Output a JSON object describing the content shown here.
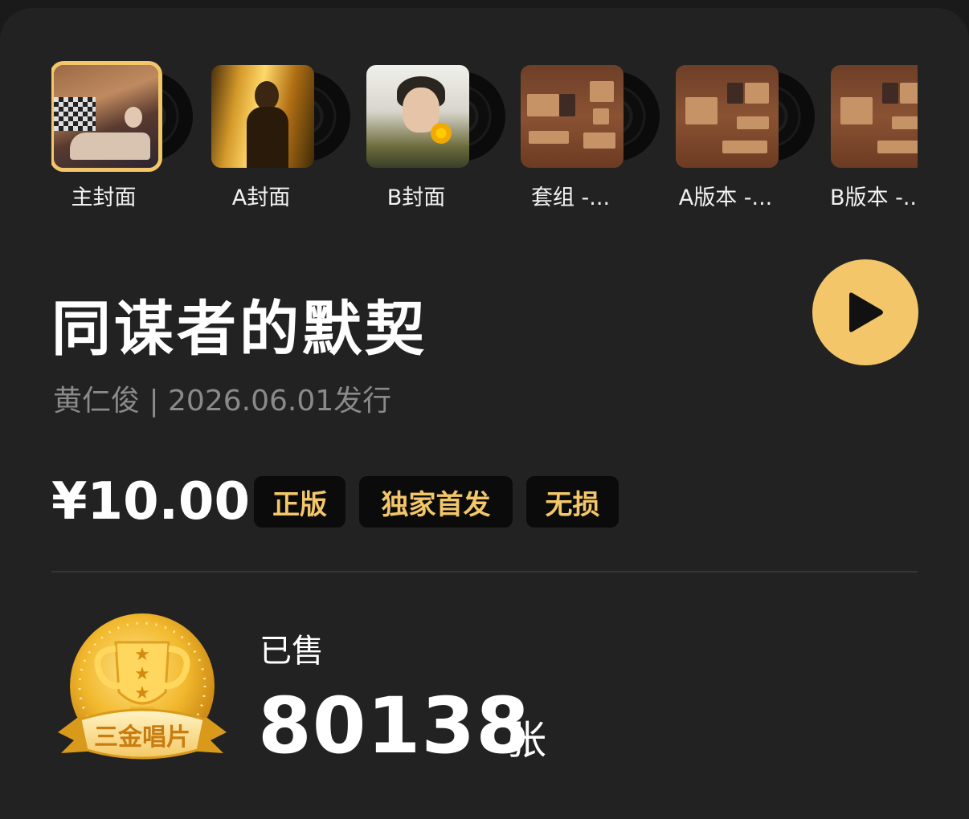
{
  "covers": [
    {
      "label": "主封面",
      "selected": true
    },
    {
      "label": "A封面",
      "selected": false
    },
    {
      "label": "B封面",
      "selected": false
    },
    {
      "label": "套组 -...",
      "selected": false
    },
    {
      "label": "A版本 -...",
      "selected": false
    },
    {
      "label": "B版本 -..",
      "selected": false
    }
  ],
  "album": {
    "title": "同谋者的默契",
    "meta": "黄仁俊 | 2026.06.01发行",
    "price": "¥10.00",
    "badges": [
      "正版",
      "独家首发",
      "无损"
    ]
  },
  "sales": {
    "label": "已售",
    "count": "80138",
    "unit": "张",
    "medal_text": "三金唱片"
  },
  "colors": {
    "accent": "#f3c669",
    "background": "#222222",
    "badge_bg": "#0b0b0b",
    "muted_text": "#8a8a8a"
  }
}
